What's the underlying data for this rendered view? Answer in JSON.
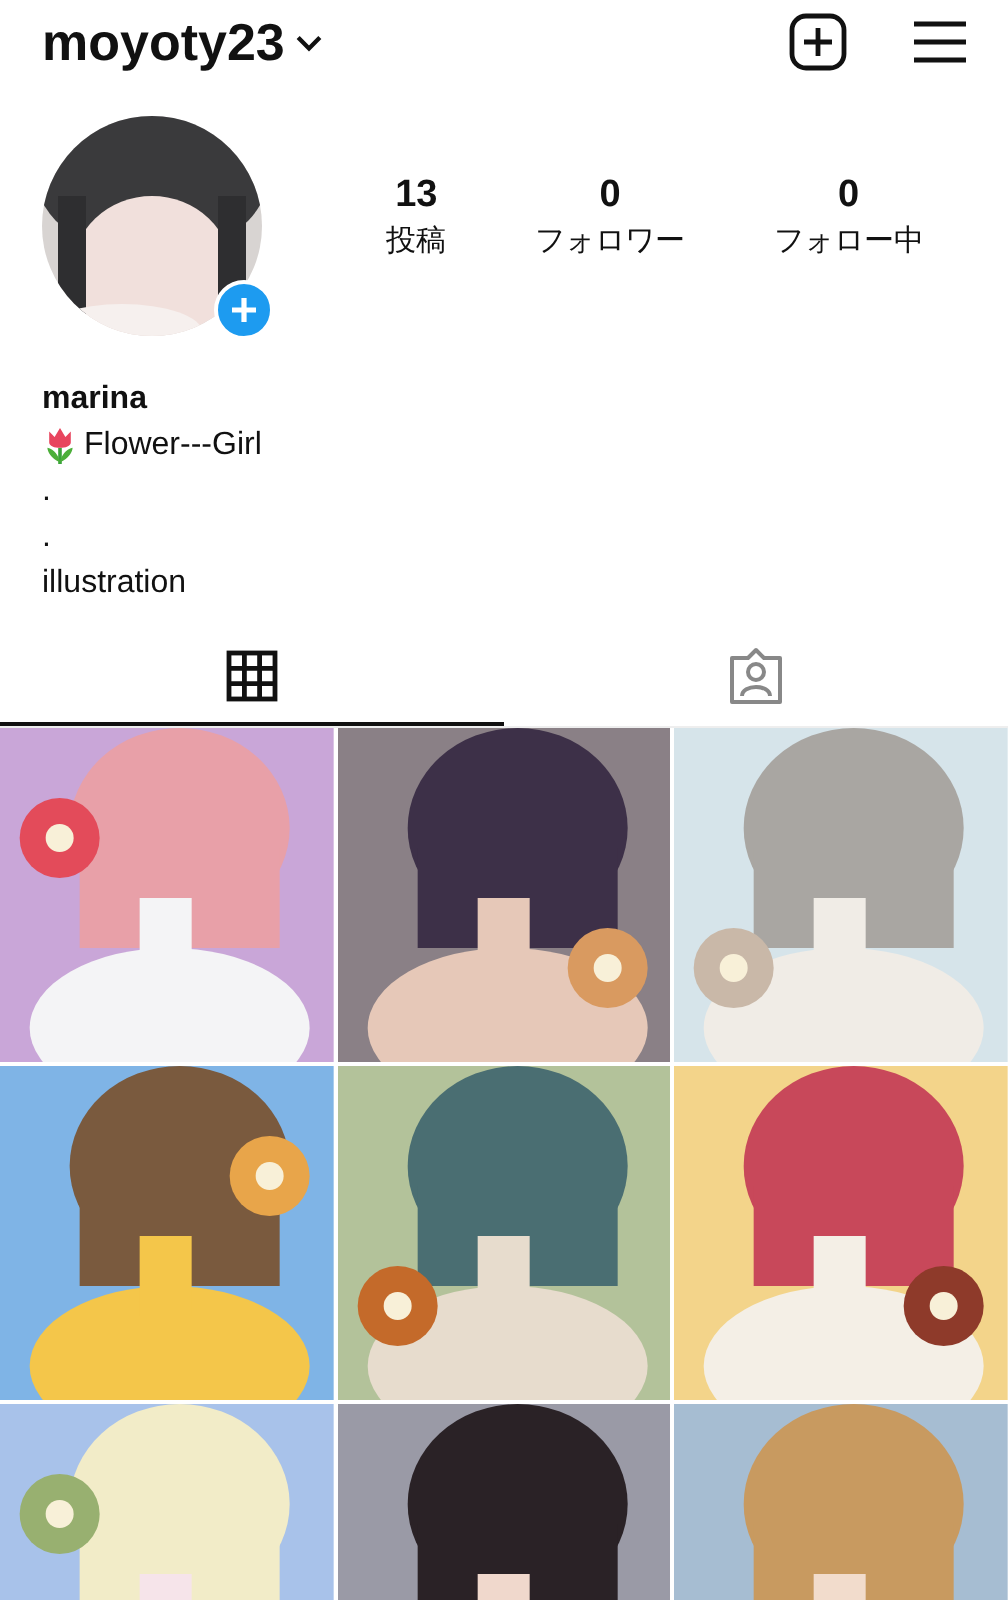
{
  "header": {
    "username": "moyoty23"
  },
  "profile": {
    "stats": [
      {
        "value": "13",
        "label": "投稿"
      },
      {
        "value": "0",
        "label": "フォロワー"
      },
      {
        "value": "0",
        "label": "フォロー中"
      }
    ],
    "name": "marina",
    "bio": [
      {
        "kind": "flower",
        "text": "Flower---Girl"
      },
      {
        "kind": "plain",
        "text": "."
      },
      {
        "kind": "plain",
        "text": "."
      },
      {
        "kind": "plain",
        "text": "illustration"
      }
    ]
  },
  "tabs": [
    {
      "kind": "grid",
      "selected": true
    },
    {
      "kind": "tagged",
      "selected": false
    }
  ]
}
